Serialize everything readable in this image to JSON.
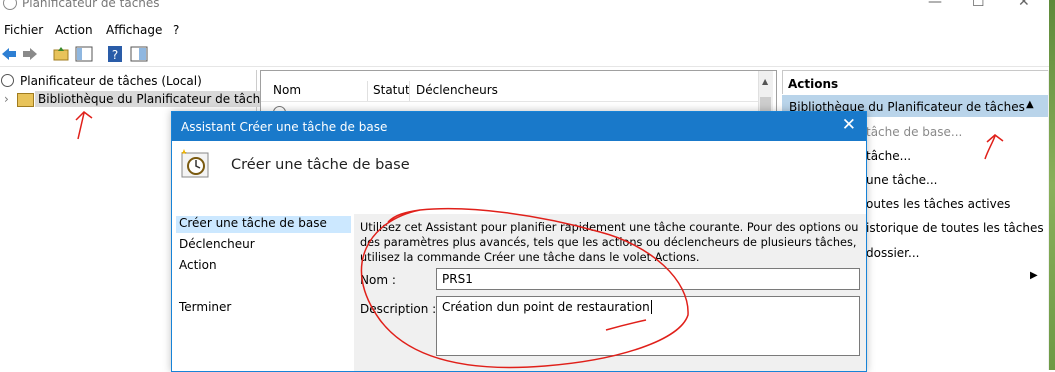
{
  "window": {
    "title": "Planificateur de tâches"
  },
  "menu": {
    "items": [
      "Fichier",
      "Action",
      "Affichage",
      "?"
    ]
  },
  "toolbar": {
    "icons": [
      "back-arrow-icon",
      "forward-arrow-icon",
      "folder-up-icon",
      "show-hide-pane-icon",
      "help-icon",
      "properties-icon"
    ]
  },
  "tree": {
    "root": "Planificateur de tâches (Local)",
    "child": "Bibliothèque du Planificateur de tâches"
  },
  "list": {
    "columns": [
      "Nom",
      "Statut",
      "Déclencheurs"
    ]
  },
  "actions": {
    "header": "Actions",
    "section": "Bibliothèque du Planificateur de tâches",
    "items": [
      "tâche de base...",
      "tâche...",
      "une tâche...",
      "outes les tâches actives",
      "istorique de toutes les tâches",
      "dossier..."
    ]
  },
  "dialog": {
    "title": "Assistant Créer une tâche de base",
    "heading": "Créer une tâche de base",
    "steps": [
      "Créer une tâche de base",
      "Déclencheur",
      "Action",
      "Terminer"
    ],
    "selected_step": 0,
    "intro": "Utilisez cet Assistant pour planifier rapidement une tâche courante. Pour des options ou des paramètres plus avancés, tels que les actions ou déclencheurs de plusieurs tâches, utilisez la commande Créer une tâche dans le volet Actions.",
    "name_label": "Nom :",
    "name_value": "PRS1",
    "description_label": "Description :",
    "description_value": "Création dun point de restauration"
  },
  "colors": {
    "accent": "#1979ca",
    "selection": "#cce8ff",
    "annotation": "#e0201a"
  }
}
